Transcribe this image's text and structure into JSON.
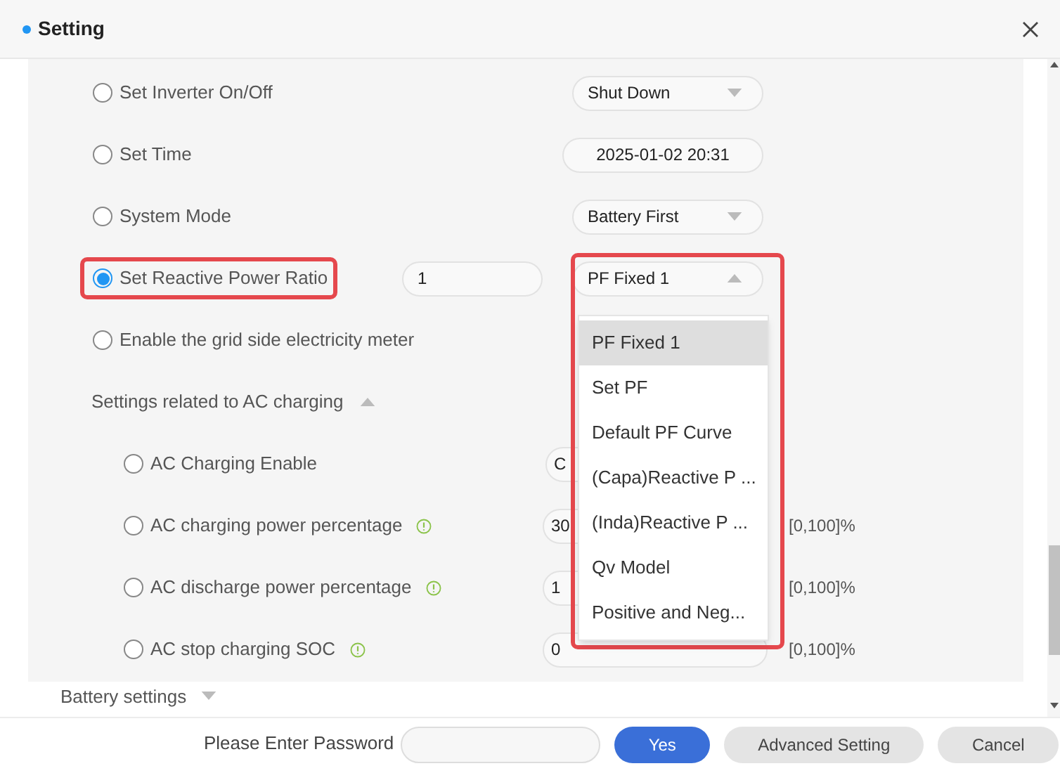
{
  "dialog": {
    "title": "Setting"
  },
  "rows": [
    {
      "kind": "select",
      "label": "Set Inverter On/Off",
      "selected": false,
      "value": "Shut Down"
    },
    {
      "kind": "datetime",
      "label": "Set Time",
      "selected": false,
      "value": "2025-01-02 20:31"
    },
    {
      "kind": "select",
      "label": "System Mode",
      "selected": false,
      "value": "Battery First"
    },
    {
      "kind": "select_input",
      "label": "Set Reactive Power Ratio",
      "selected": true,
      "highlighted": true,
      "input": "1",
      "value": "PF Fixed 1",
      "open": true
    },
    {
      "kind": "plain",
      "label": "Enable the grid side electricity meter",
      "selected": false
    }
  ],
  "section": {
    "label": "Settings related to AC charging",
    "expanded": true,
    "rows": [
      {
        "kind": "select",
        "label": "AC Charging Enable",
        "selected": false,
        "value": "C"
      },
      {
        "kind": "number",
        "label": "AC charging power percentage",
        "selected": false,
        "info": true,
        "value": "30",
        "range": "[0,100]%"
      },
      {
        "kind": "number",
        "label": "AC discharge power percentage",
        "selected": false,
        "info": true,
        "value": "1",
        "range": "[0,100]%"
      },
      {
        "kind": "number",
        "label": "AC stop charging SOC",
        "selected": false,
        "info": true,
        "value": "0",
        "range": "[0,100]%"
      }
    ]
  },
  "next_section": {
    "label": "Battery settings",
    "expanded": false
  },
  "dropdown": {
    "highlighted": true,
    "options": [
      {
        "label": "PF Fixed 1",
        "selected": true
      },
      {
        "label": "Set PF",
        "selected": false
      },
      {
        "label": "Default PF Curve",
        "selected": false
      },
      {
        "label": "(Capa)Reactive P ...",
        "selected": false
      },
      {
        "label": "(Inda)Reactive P ...",
        "selected": false
      },
      {
        "label": "Qv Model",
        "selected": false
      },
      {
        "label": "Positive and Neg...",
        "selected": false
      }
    ]
  },
  "footer": {
    "password_label": "Please Enter Password",
    "buttons": [
      {
        "kind": "primary",
        "label": "Yes"
      },
      {
        "kind": "secondary",
        "label": "Advanced Setting"
      },
      {
        "kind": "secondary",
        "label": "Cancel"
      }
    ]
  }
}
